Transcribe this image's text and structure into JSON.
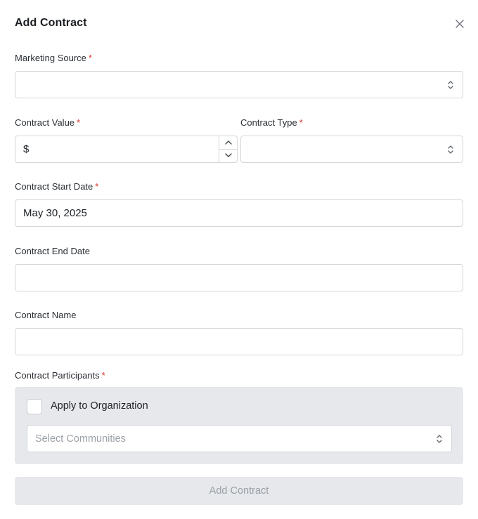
{
  "dialog": {
    "title": "Add Contract"
  },
  "fields": {
    "marketing_source": {
      "label": "Marketing Source",
      "required_mark": "*",
      "value": ""
    },
    "contract_value": {
      "label": "Contract Value",
      "required_mark": "*",
      "prefix": "$",
      "value": ""
    },
    "contract_type": {
      "label": "Contract Type",
      "required_mark": "*",
      "value": ""
    },
    "start_date": {
      "label": "Contract Start Date",
      "required_mark": "*",
      "value": "May 30, 2025"
    },
    "end_date": {
      "label": "Contract End Date",
      "value": ""
    },
    "contract_name": {
      "label": "Contract Name",
      "value": ""
    }
  },
  "participants": {
    "label": "Contract Participants",
    "required_mark": "*",
    "apply_to_org_label": "Apply to Organization",
    "apply_to_org_checked": false,
    "communities_placeholder": "Select Communities"
  },
  "submit_label": "Add Contract",
  "icons": {
    "close": "close-icon",
    "select": "chevron-up-down-icon",
    "stepper_up": "chevron-up-icon",
    "stepper_down": "chevron-down-icon"
  },
  "colors": {
    "required": "#d9342b",
    "panel_bg": "#e6e8eb",
    "border": "#d3d6da",
    "disabled_text": "#9aa0a7"
  }
}
